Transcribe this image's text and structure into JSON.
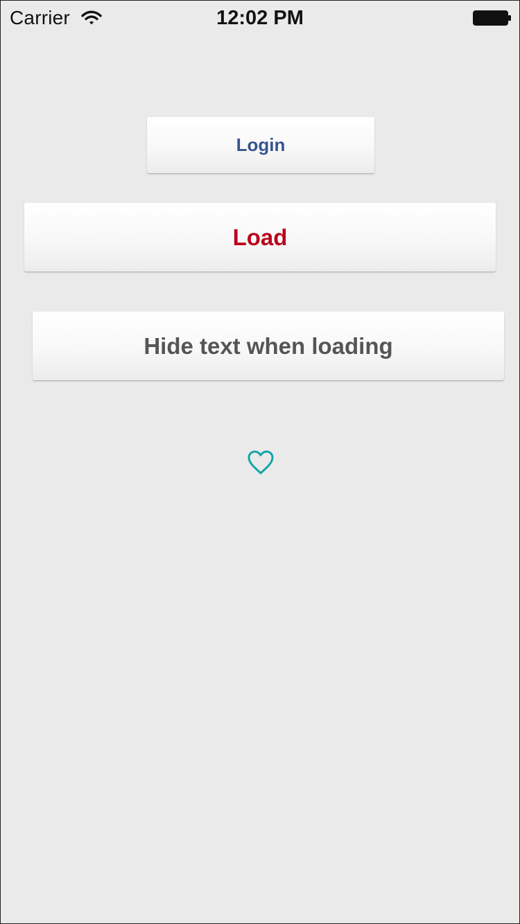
{
  "status_bar": {
    "carrier": "Carrier",
    "time": "12:02 PM",
    "wifi_icon": "wifi-icon",
    "battery_icon": "battery-icon"
  },
  "buttons": {
    "login": {
      "label": "Login",
      "color": "#36558f"
    },
    "load": {
      "label": "Load",
      "color": "#b8041c"
    },
    "hide_text": {
      "label": "Hide text when loading",
      "color": "#555555"
    }
  },
  "icons": {
    "heart": {
      "name": "heart-outline-icon",
      "color": "#11a6a8"
    }
  },
  "colors": {
    "background": "#eaeaea"
  }
}
